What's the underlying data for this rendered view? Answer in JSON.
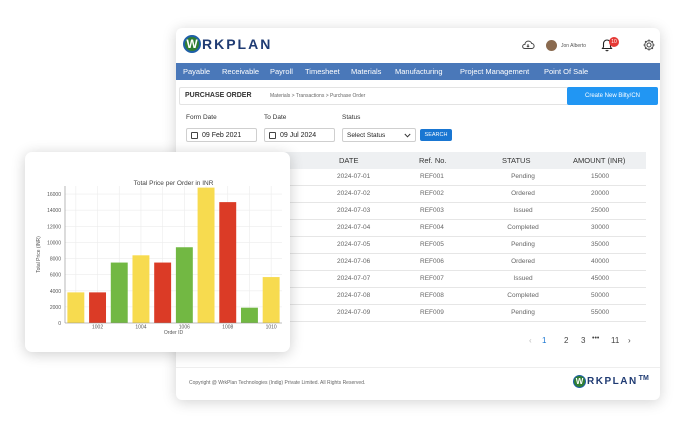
{
  "app": {
    "brand_initial": "W",
    "brand_text": "RKPLAN",
    "user_name": "Jon Alberto",
    "notification_count": "10",
    "menu": [
      "Payable",
      "Receivable",
      "Payroll",
      "Timesheet",
      "Materials",
      "Manufacturing",
      "Project Management",
      "Point Of Sale"
    ],
    "page_title": "PURCHASE ORDER",
    "breadcrumb": "Materials > Transactions > Purchase Order",
    "create_button": "Create New Bilty/CN",
    "filters": {
      "from_label": "Form Date",
      "from_value": "09 Feb 2021",
      "to_label": "To Date",
      "to_value": "09 Jul 2024",
      "status_label": "Status",
      "status_value": "Select Status",
      "search_button": "SEARCH"
    },
    "table": {
      "headers": [
        "DATE",
        "Ref. No.",
        "STATUS",
        "AMOUNT (INR)"
      ],
      "rows": [
        [
          "2024-07-01",
          "REF001",
          "Pending",
          "15000"
        ],
        [
          "2024-07-02",
          "REF002",
          "Ordered",
          "20000"
        ],
        [
          "2024-07-03",
          "REF003",
          "Issued",
          "25000"
        ],
        [
          "2024-07-04",
          "REF004",
          "Completed",
          "30000"
        ],
        [
          "2024-07-05",
          "REF005",
          "Pending",
          "35000"
        ],
        [
          "2024-07-06",
          "REF006",
          "Ordered",
          "40000"
        ],
        [
          "2024-07-07",
          "REF007",
          "Issued",
          "45000"
        ],
        [
          "2024-07-08",
          "REF008",
          "Completed",
          "50000"
        ],
        [
          "2024-07-09",
          "REF009",
          "Pending",
          "55000"
        ]
      ]
    },
    "pagination": {
      "prev": "‹",
      "pages": [
        "1",
        "2",
        "3"
      ],
      "ellipsis": "•••",
      "last": "11",
      "next": "›",
      "active": "1"
    },
    "footer": {
      "copyright": "Copyright @ WrkPlan Technologies (Indig) Private Limited. All Rights Reserved.",
      "brand_text": "RKPLAN",
      "tm": "TM"
    }
  },
  "chart_data": {
    "type": "bar",
    "title": "Total Price per Order in INR",
    "xlabel": "Order ID",
    "ylabel": "Total Price (INR)",
    "ylim": [
      0,
      17000
    ],
    "yticks": [
      0,
      2000,
      4000,
      6000,
      8000,
      10000,
      12000,
      14000,
      16000
    ],
    "xtick_labels": [
      "1002",
      "1004",
      "1006",
      "1008",
      "1010"
    ],
    "grid": true,
    "values": [
      3800,
      3800,
      7500,
      8400,
      7500,
      9400,
      16800,
      15000,
      1900,
      5700
    ],
    "colors": [
      "#f7db4f",
      "#db3b26",
      "#72b843",
      "#f7db4f",
      "#db3b26",
      "#72b843",
      "#f7db4f",
      "#db3b26",
      "#72b843",
      "#f7db4f"
    ]
  }
}
